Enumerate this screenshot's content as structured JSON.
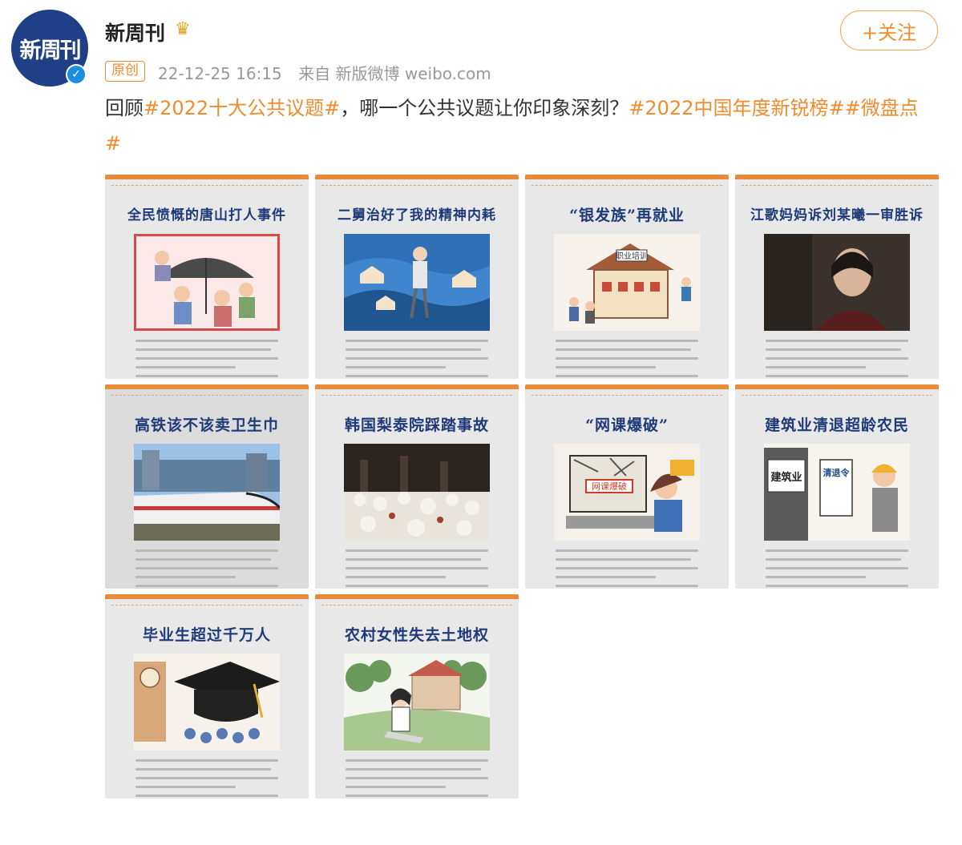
{
  "account": {
    "avatar_text": "新周刊",
    "name": "新周刊",
    "follow_label": "+关注"
  },
  "meta": {
    "badge": "原创",
    "time": "22-12-25 16:15",
    "source": "来自 新版微博 weibo.com"
  },
  "post": {
    "prefix": "回顾",
    "tag1": "#2022十大公共议题#",
    "middle": "，哪一个公共议题让你印象深刻？",
    "tag2": "#2022中国年度新锐榜#",
    "tag3": "#微盘点#"
  },
  "cards": [
    {
      "title": "全民愤慨的唐山打人事件"
    },
    {
      "title": "二舅治好了我的精神内耗"
    },
    {
      "title": "“银发族”再就业"
    },
    {
      "title": "江歌妈妈诉刘某曦一审胜诉"
    },
    {
      "title": "高铁该不该卖卫生巾"
    },
    {
      "title": "韩国梨泰院踩踏事故"
    },
    {
      "title": "“网课爆破”"
    },
    {
      "title": "建筑业清退超龄农民"
    },
    {
      "title": "毕业生超过千万人"
    },
    {
      "title": "农村女性失去土地权"
    }
  ],
  "illustration_labels": {
    "training": "职业培训",
    "net_class": "网课爆破",
    "construction": "建筑业",
    "order": "清退令"
  },
  "colors": {
    "accent": "#f08c2e",
    "card_title": "#1f3a78",
    "card_bg": "#e8e8e8"
  }
}
